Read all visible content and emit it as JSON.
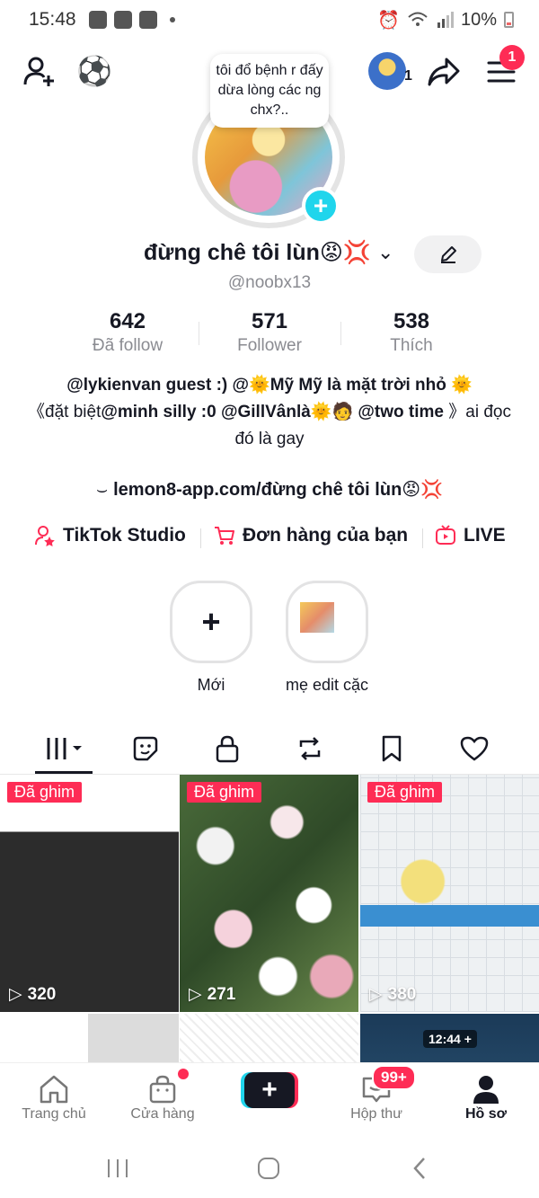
{
  "status": {
    "time": "15:48",
    "battery": "10%"
  },
  "topbar": {
    "avatar_count": "1",
    "menu_badge": "1"
  },
  "profile": {
    "bubble_note": "tôi đổ bệnh r đấy dừa lòng các ng chx?..",
    "display_name": "đừng chê tôi lùn😡💢",
    "username": "@noobx13"
  },
  "stats": [
    {
      "value": "642",
      "label": "Đã follow"
    },
    {
      "value": "571",
      "label": "Follower"
    },
    {
      "value": "538",
      "label": "Thích"
    }
  ],
  "bio": {
    "line1": "@lykienvan guest :) @🌞Mỹ Mỹ là mặt trời nhỏ 🌞",
    "line2_prefix": "《đặt biệt",
    "line2_bold": "@minh silly :0 @GillVânlà🌞🧑 @two time",
    "line2_suffix": "》ai đọc đó là gay",
    "link": "lemon8-app.com/đừng chê tôi lùn😡💢"
  },
  "quick_links": [
    {
      "label": "TikTok Studio",
      "icon": "person-star-icon"
    },
    {
      "label": "Đơn hàng của bạn",
      "icon": "cart-icon"
    },
    {
      "label": "LIVE",
      "icon": "tv-icon"
    }
  ],
  "highlights": [
    {
      "label": "Mới"
    },
    {
      "label": "mẹ edit cặc"
    }
  ],
  "videos": [
    {
      "pinned": "Đã ghim",
      "views": "320"
    },
    {
      "pinned": "Đã ghim",
      "views": "271"
    },
    {
      "pinned": "Đã ghim",
      "views": "380"
    },
    {
      "hud": "12:44 +"
    }
  ],
  "nav": {
    "home": "Trang chủ",
    "shop": "Cửa hàng",
    "inbox": "Hộp thư",
    "inbox_badge": "99+",
    "profile": "Hồ sơ"
  },
  "colors": {
    "accent": "#fe2c55",
    "cyan": "#20d5ec",
    "text": "#161823",
    "muted": "#8a8b91"
  }
}
